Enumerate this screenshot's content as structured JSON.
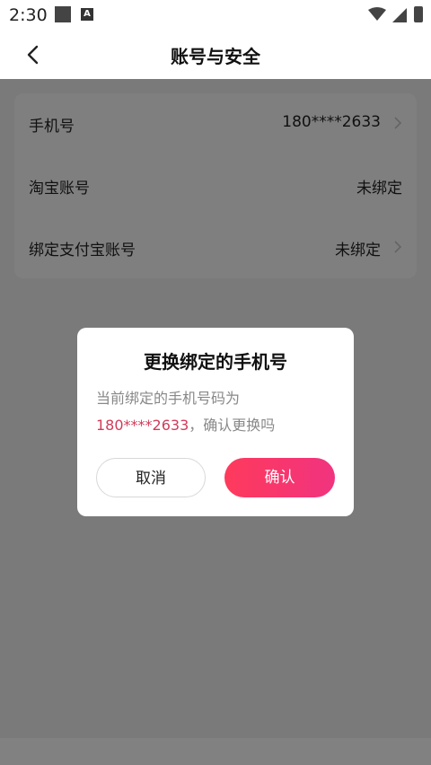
{
  "status_bar": {
    "time": "2:30",
    "notification_icons": [
      "square-app-icon",
      "a-badge-icon"
    ],
    "system_icons": [
      "wifi-icon",
      "signal-icon",
      "battery-icon"
    ]
  },
  "header": {
    "title": "账号与安全",
    "back_icon": "chevron-left-icon"
  },
  "settings": {
    "rows": [
      {
        "label": "手机号",
        "value": "180****2633",
        "has_chevron": true
      },
      {
        "label": "淘宝账号",
        "value": "未绑定",
        "has_chevron": false
      },
      {
        "label": "绑定支付宝账号",
        "value": "未绑定",
        "has_chevron": true
      }
    ]
  },
  "dialog": {
    "title": "更换绑定的手机号",
    "message_prefix": "当前绑定的手机号码为",
    "phone": "180****2633",
    "message_suffix": "，确认更换吗",
    "cancel_label": "取消",
    "confirm_label": "确认"
  },
  "colors": {
    "accent": "#f1337f",
    "accent_start": "#fe3a5c",
    "phone_highlight": "#d23a5a",
    "overlay": "rgba(0,0,0,0.5)"
  }
}
